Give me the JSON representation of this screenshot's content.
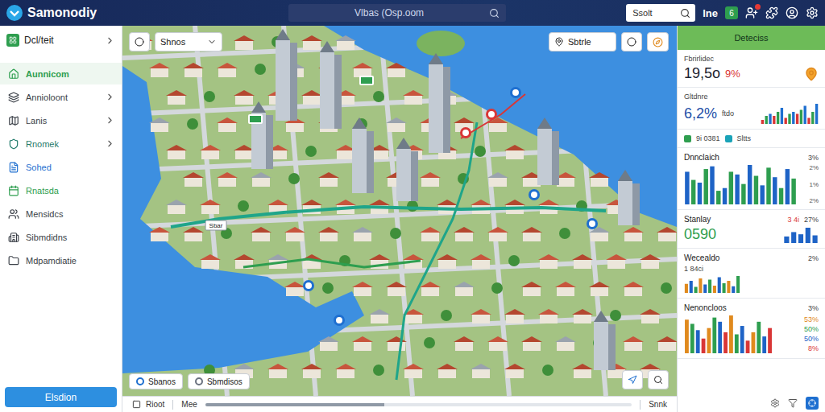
{
  "app": {
    "title": "Samonodiy"
  },
  "topbar": {
    "search": {
      "placeholder": "Vlbas (Osp.oom"
    },
    "quick_search": {
      "placeholder": "Ssolt"
    },
    "status": {
      "label": "lne",
      "badge": "6"
    },
    "alerts": {
      "unread": true
    }
  },
  "sidebar": {
    "header": {
      "label": "Dcl/teit",
      "expandable": true
    },
    "items": [
      {
        "label": "Aunnicom",
        "selected": true,
        "expandable": false,
        "color": "#2e9e4f"
      },
      {
        "label": "Annioloont",
        "selected": false,
        "expandable": true,
        "color": "#3a3f47"
      },
      {
        "label": "Lanis",
        "selected": false,
        "expandable": true,
        "color": "#3a3f47"
      },
      {
        "label": "Rnomek",
        "selected": false,
        "expandable": true,
        "color": "#1f7a6a"
      },
      {
        "label": "Sohed",
        "selected": false,
        "expandable": false,
        "color": "#1e6fd0"
      },
      {
        "label": "Rnatsda",
        "selected": false,
        "expandable": false,
        "color": "#2e9e4f"
      },
      {
        "label": "Mensidcs",
        "selected": false,
        "expandable": false,
        "color": "#3a3f47"
      },
      {
        "label": "Sibmdidns",
        "selected": false,
        "expandable": false,
        "color": "#3a3f47"
      },
      {
        "label": "Mdpamdiatie",
        "selected": false,
        "expandable": false,
        "color": "#3a3f47"
      }
    ],
    "button": "Elsdion"
  },
  "map": {
    "layer_select": {
      "label": "Shnos"
    },
    "filter_button": {
      "label": "Sbtrle"
    },
    "chips": [
      {
        "label": "Sbanos",
        "color": "#1e6fd0"
      },
      {
        "label": "Sbmdisos",
        "color": "#6b7280"
      }
    ],
    "pins": [
      {
        "kind": "sign",
        "color": "#2e9e4f"
      },
      {
        "kind": "sign",
        "color": "#2e9e4f"
      },
      {
        "kind": "pin",
        "color": "#d93636"
      },
      {
        "kind": "pin",
        "color": "#d93636"
      },
      {
        "kind": "pin",
        "color": "#1e6fd0"
      },
      {
        "kind": "pin",
        "color": "#1e6fd0"
      },
      {
        "kind": "pin",
        "color": "#1e6fd0"
      },
      {
        "kind": "pin",
        "color": "#1e6fd0"
      },
      {
        "kind": "pin",
        "color": "#1e6fd0"
      },
      {
        "kind": "tag",
        "color": "#ffffff",
        "label": "Sbar"
      }
    ],
    "timeline": {
      "start": "Rioot",
      "label": "Mee",
      "end": "Snnk",
      "level": 0.42
    }
  },
  "panel": {
    "title": "Deteciss",
    "summary": {
      "label": "Fbrirlidec",
      "value": "19,5o",
      "change": "9%"
    },
    "rate": {
      "label": "Gltdnre",
      "value": "6,2%",
      "unit": "ftdo",
      "series": [
        {
          "color": "#d93636",
          "values": [
            2,
            4,
            3,
            5,
            3
          ]
        },
        {
          "color": "#2e9e4f",
          "values": [
            4,
            6,
            5,
            7,
            6
          ]
        },
        {
          "color": "#1e6fd0",
          "values": [
            5,
            8,
            6,
            9,
            10
          ]
        }
      ]
    },
    "counters": [
      {
        "label": "9i 0381",
        "color": "#2e9e4f"
      },
      {
        "label": "Sltts",
        "color": "#1aa3b8"
      }
    ],
    "distribution": {
      "title": "Dnnclaich",
      "value": "3%",
      "ticks": [
        "2%",
        "1%",
        "2%"
      ],
      "series": [
        {
          "color": "#1e63c6",
          "values": [
            2.4,
            1.6,
            2.8,
            1.2,
            2.2,
            2.9,
            1.4,
            2.0,
            2.6
          ]
        },
        {
          "color": "#2e9e4f",
          "values": [
            1.8,
            2.6,
            1.0,
            2.4,
            1.5,
            2.1,
            2.7,
            1.2,
            1.9
          ]
        }
      ]
    },
    "stability": {
      "title": "Stanlay",
      "note": "3 4i",
      "value": "27%",
      "figure": "0590",
      "series": [
        {
          "color": "#1e63c6",
          "values": [
            1.2,
            2.0,
            1.6,
            2.8,
            1.4
          ]
        }
      ]
    },
    "weekly": {
      "title": "Wecealdo",
      "value": "2%",
      "note": "1 84ci",
      "series": [
        {
          "color": "#e08a1e",
          "values": [
            1.5,
            2.4,
            1.2,
            2.0
          ]
        },
        {
          "color": "#1e63c6",
          "values": [
            2.0,
            1.4,
            2.6,
            1.1
          ]
        },
        {
          "color": "#2e9e4f",
          "values": [
            1.0,
            2.2,
            1.6,
            2.8
          ]
        }
      ]
    },
    "monitoring": {
      "title": "Nenoncloos",
      "value": "3%",
      "series": [
        {
          "color": "#e08a1e",
          "values": [
            3.2,
            2.4,
            3.6,
            2.0
          ]
        },
        {
          "color": "#2e9e4f",
          "values": [
            2.8,
            3.4,
            1.8,
            3.0
          ]
        },
        {
          "color": "#1e63c6",
          "values": [
            2.2,
            3.0,
            2.6,
            1.6
          ]
        },
        {
          "color": "#d93636",
          "values": [
            1.4,
            2.0,
            1.2,
            2.4
          ]
        }
      ],
      "readings": [
        {
          "label": "53%",
          "color": "#e08a1e"
        },
        {
          "label": "50%",
          "color": "#2e9e4f"
        },
        {
          "label": "50%",
          "color": "#1e63c6"
        },
        {
          "label": "8%",
          "color": "#d93636"
        }
      ]
    }
  }
}
